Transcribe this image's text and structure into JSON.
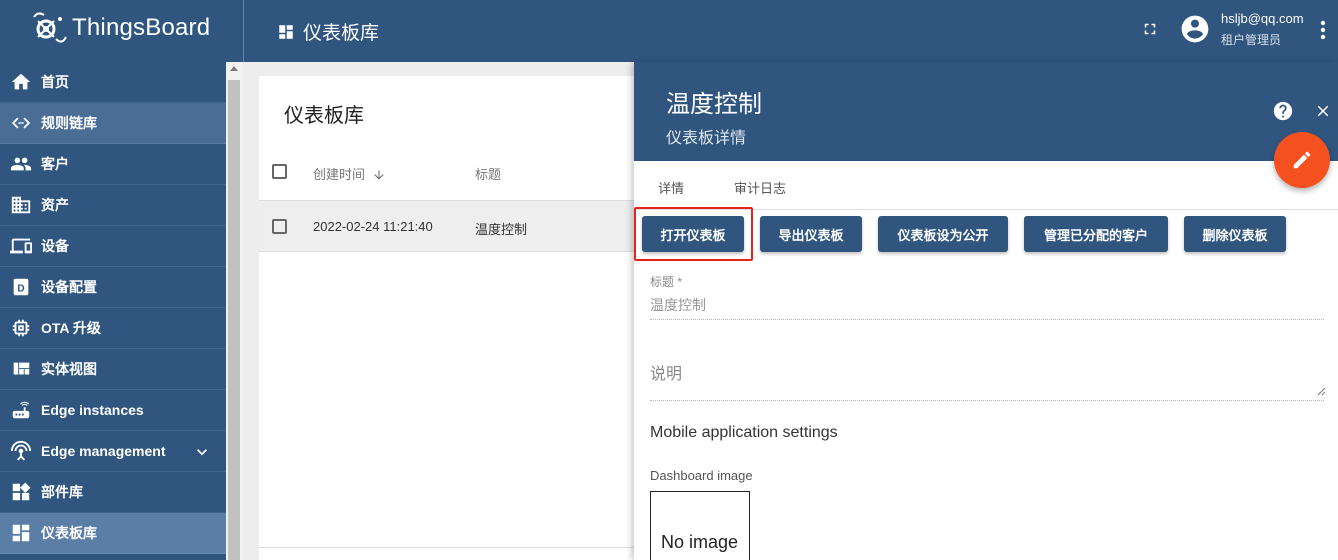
{
  "app": {
    "name": "ThingsBoard",
    "page_title": "仪表板库",
    "user_email": "hsljb@qq.com",
    "user_role": "租户管理员"
  },
  "sidebar": {
    "items": [
      {
        "label": "首页",
        "icon": "home-icon"
      },
      {
        "label": "规则链库",
        "icon": "code-icon"
      },
      {
        "label": "客户",
        "icon": "people-icon"
      },
      {
        "label": "资产",
        "icon": "domain-icon"
      },
      {
        "label": "设备",
        "icon": "devices-icon"
      },
      {
        "label": "设备配置",
        "icon": "device-profile-icon"
      },
      {
        "label": "OTA 升级",
        "icon": "memory-icon"
      },
      {
        "label": "实体视图",
        "icon": "view-quilt-icon"
      },
      {
        "label": "Edge instances",
        "icon": "router-icon"
      },
      {
        "label": "Edge management",
        "icon": "settings-input-antenna-icon"
      },
      {
        "label": "部件库",
        "icon": "widgets-icon"
      },
      {
        "label": "仪表板库",
        "icon": "dashboards-icon"
      }
    ]
  },
  "list": {
    "title": "仪表板库",
    "columns": [
      "创建时间",
      "标题"
    ],
    "rows": [
      {
        "created": "2022-02-24 11:21:40",
        "title": "温度控制"
      }
    ]
  },
  "details": {
    "title": "温度控制",
    "subtitle": "仪表板详情",
    "tabs": [
      "详情",
      "审计日志"
    ],
    "buttons": [
      "打开仪表板",
      "导出仪表板",
      "仪表板设为公开",
      "管理已分配的客户",
      "删除仪表板"
    ],
    "title_field_label": "标题 *",
    "title_field_value": "温度控制",
    "description_label": "说明",
    "mobile_section": "Mobile application settings",
    "image_label": "Dashboard image",
    "no_image": "No image"
  },
  "colors": {
    "primary": "#305680",
    "fab": "#f4511e",
    "highlight": "#e5231d"
  }
}
